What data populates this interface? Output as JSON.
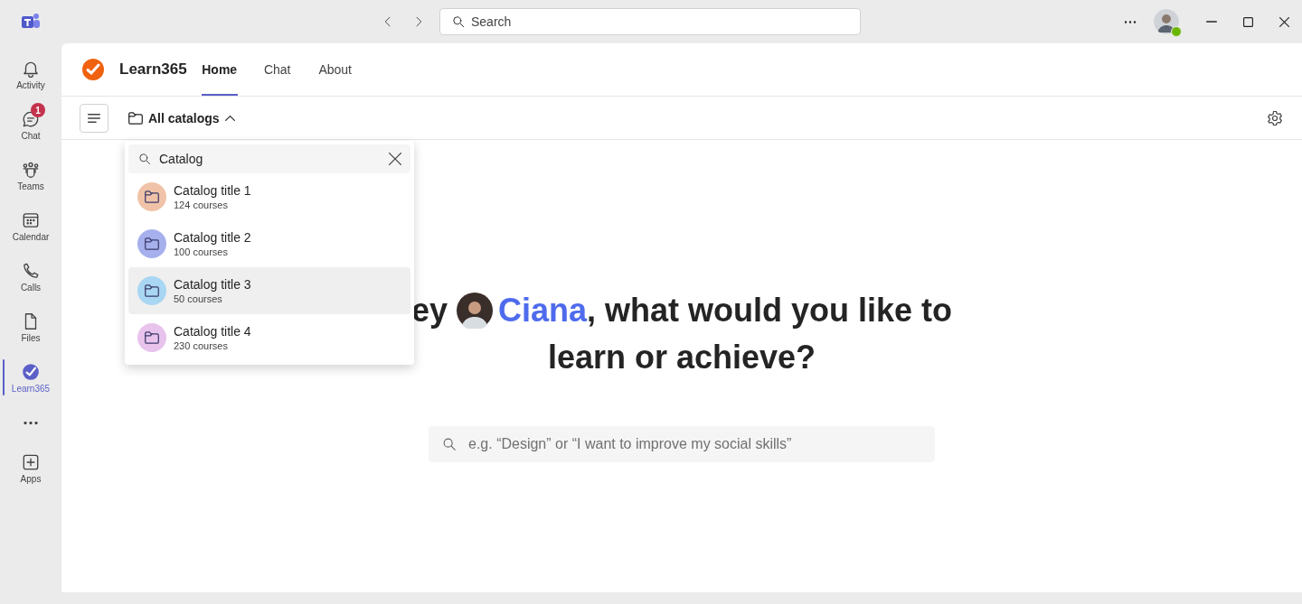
{
  "titlebar": {
    "search": {
      "placeholder": "Search"
    },
    "status_online": true
  },
  "sidebar": {
    "items": [
      {
        "kind": "bell",
        "label": "Activity",
        "selected": false
      },
      {
        "kind": "chat",
        "label": "Chat",
        "selected": false,
        "badge": "1"
      },
      {
        "kind": "teams",
        "label": "Teams",
        "selected": false
      },
      {
        "kind": "calendar",
        "label": "Calendar",
        "selected": false
      },
      {
        "kind": "calls",
        "label": "Calls",
        "selected": false
      },
      {
        "kind": "files",
        "label": "Files",
        "selected": false
      },
      {
        "kind": "learn",
        "label": "Learn365",
        "selected": true
      },
      {
        "kind": "more",
        "selected": false
      },
      {
        "kind": "apps",
        "label": "Apps",
        "selected": false
      }
    ]
  },
  "app": {
    "name": "Learn365",
    "tabs": [
      {
        "label": "Home",
        "selected": true
      },
      {
        "label": "Chat",
        "selected": false
      },
      {
        "label": "About",
        "selected": false
      }
    ]
  },
  "toolbar": {
    "catalog_button": "All catalogs",
    "expanded": true
  },
  "dropdown": {
    "search": {
      "value": "Catalog"
    },
    "items": [
      {
        "title": "Catalog title 1",
        "subtitle": "124 courses",
        "color": "#f0c3a8",
        "selected": false
      },
      {
        "title": "Catalog title 2",
        "subtitle": "100 courses",
        "color": "#a6b0ec",
        "selected": false
      },
      {
        "title": "Catalog title 3",
        "subtitle": "50 courses",
        "color": "#a9d6f2",
        "selected": true
      },
      {
        "title": "Catalog title 4",
        "subtitle": "230 courses",
        "color": "#e8c3ec",
        "selected": false
      }
    ]
  },
  "hero": {
    "greeting": "ey",
    "name": "Ciana",
    "question_lines": [
      ", what would you like to",
      "learn or achieve?"
    ],
    "search": {
      "placeholder": "e.g. “Design” or “I want to improve my social skills”"
    }
  }
}
